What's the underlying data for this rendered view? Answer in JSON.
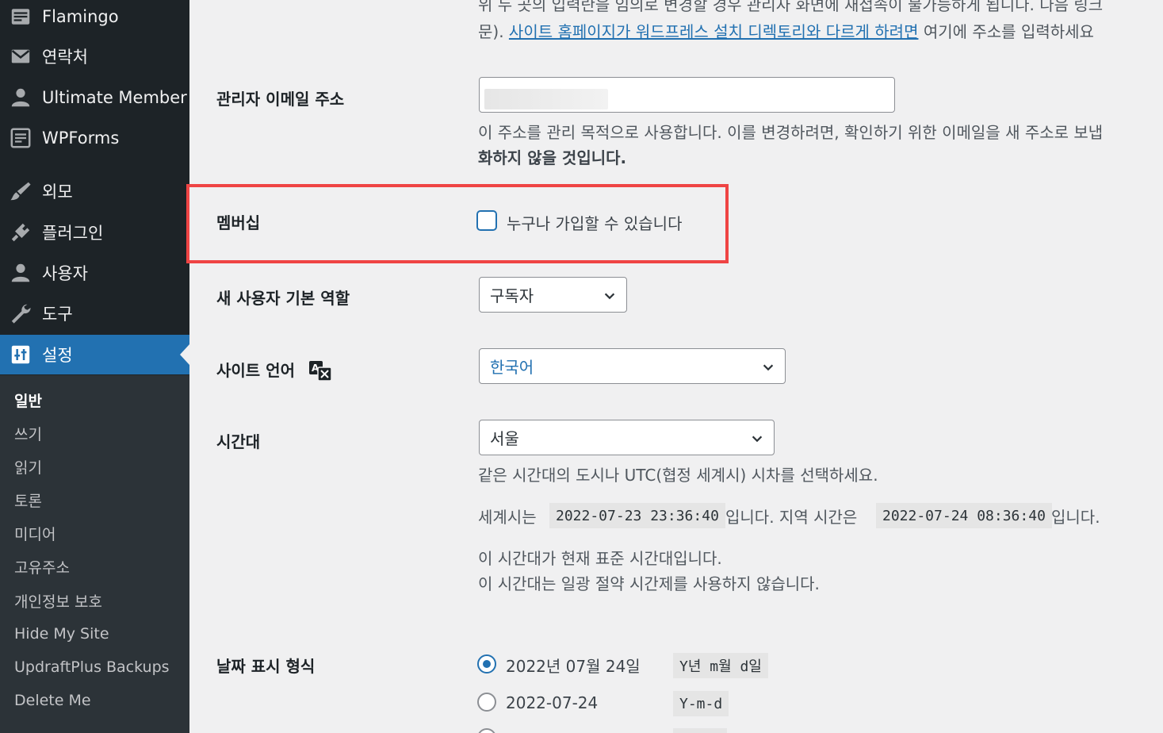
{
  "sidebar": {
    "items": [
      {
        "label": "Flamingo",
        "icon": "inbox-icon"
      },
      {
        "label": "연락처",
        "icon": "mail-icon"
      },
      {
        "label": "Ultimate Member",
        "icon": "user-icon"
      },
      {
        "label": "WPForms",
        "icon": "form-icon"
      },
      {
        "label": "외모",
        "icon": "brush-icon"
      },
      {
        "label": "플러그인",
        "icon": "plugin-icon"
      },
      {
        "label": "사용자",
        "icon": "users-icon"
      },
      {
        "label": "도구",
        "icon": "wrench-icon"
      },
      {
        "label": "설정",
        "icon": "settings-icon"
      }
    ],
    "submenu": [
      "일반",
      "쓰기",
      "읽기",
      "토론",
      "미디어",
      "고유주소",
      "개인정보 보호",
      "Hide My Site",
      "UpdraftPlus Backups",
      "Delete Me"
    ]
  },
  "top_text": {
    "line1": "위 두 곳의 입력란을 임의로 변경할 경우 관리자 화면에 재접속이 불가능하게 됩니다. 다음 링크",
    "line2_prefix": "문). ",
    "line2_link": "사이트 홈페이지가 워드프레스 설치 디렉토리와 다르게 하려면",
    "line2_suffix": " 여기에 주소를 입력하세요"
  },
  "admin_email": {
    "label": "관리자 이메일 주소",
    "desc1": "이 주소를 관리 목적으로 사용합니다. 이를 변경하려면, 확인하기 위한 이메일을 새 주소로 보냅",
    "desc2": "화하지 않을 것입니다."
  },
  "membership": {
    "label": "멤버십",
    "checkbox_label": "누구나 가입할 수 있습니다"
  },
  "default_role": {
    "label": "새 사용자 기본 역할",
    "value": "구독자"
  },
  "site_language": {
    "label": "사이트 언어",
    "value": "한국어"
  },
  "timezone": {
    "label": "시간대",
    "value": "서울",
    "desc": "같은 시간대의 도시나 UTC(협정 세계시) 시차를 선택하세요.",
    "utc_prefix": "세계시는",
    "utc_time": "2022-07-23 23:36:40",
    "utc_mid": "입니다. 지역 시간은",
    "local_time": "2022-07-24 08:36:40",
    "local_suffix": "입니다.",
    "note1": "이 시간대가 현재 표준 시간대입니다.",
    "note2": "이 시간대는 일광 절약 시간제를 사용하지 않습니다."
  },
  "date_format": {
    "label": "날짜 표시 형식",
    "options": [
      {
        "label": "2022년 07월 24일",
        "code": "Y년 m월 d일",
        "checked": true
      },
      {
        "label": "2022-07-24",
        "code": "Y-m-d",
        "checked": false
      }
    ]
  }
}
